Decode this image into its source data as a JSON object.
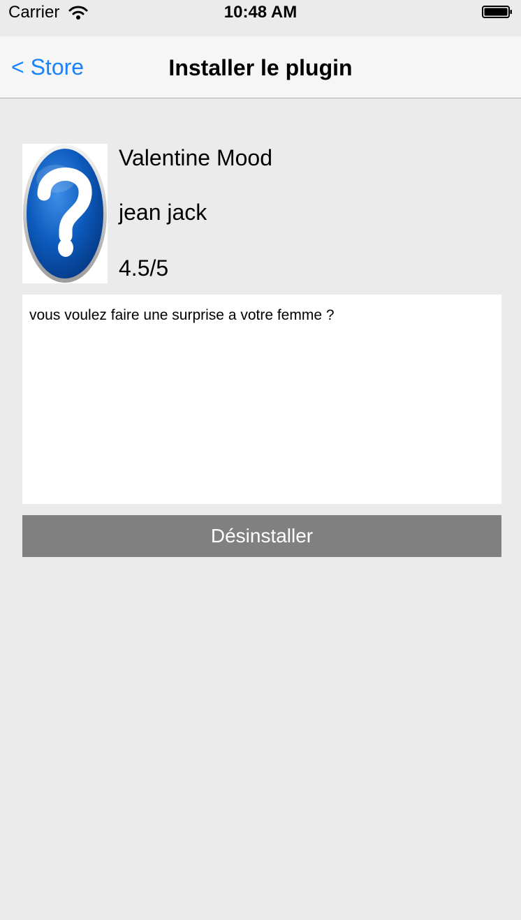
{
  "status_bar": {
    "carrier": "Carrier",
    "time": "10:48 AM",
    "wifi_icon": "wifi-icon",
    "battery_icon": "battery-icon"
  },
  "nav": {
    "back_label": "< Store",
    "title": "Installer le plugin"
  },
  "plugin": {
    "icon": "question-mark-icon",
    "name": "Valentine Mood",
    "author": "jean jack",
    "rating": "4.5/5",
    "description": "vous voulez faire une surprise a votre femme ?"
  },
  "actions": {
    "uninstall_label": "Désinstaller"
  },
  "colors": {
    "accent": "#1a82fb",
    "background": "#ebebeb",
    "nav_background": "#f6f6f6",
    "button_background": "#808080",
    "icon_blue": "#0a57b8"
  }
}
